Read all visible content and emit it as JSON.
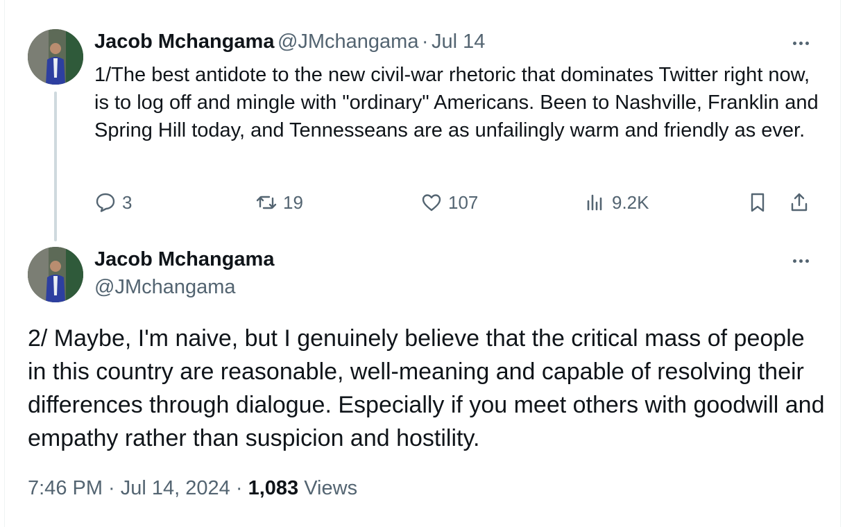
{
  "colors": {
    "text_primary": "#0f1419",
    "text_secondary": "#536471",
    "thread_line": "#cfd9de"
  },
  "tweet1": {
    "author_name": "Jacob Mchangama",
    "handle": "@JMchangama",
    "separator": "·",
    "date": "Jul 14",
    "text": "1/The best antidote to the new civil-war rhetoric that dominates Twitter right now, is to log off and mingle with \"ordinary\" Americans. Been to Nashville, Franklin and Spring Hill today, and Tennesseans are as unfailingly warm and friendly as ever.",
    "actions": {
      "replies": "3",
      "reposts": "19",
      "likes": "107",
      "views": "9.2K"
    },
    "icons": [
      "reply-icon",
      "repost-icon",
      "like-icon",
      "views-icon",
      "bookmark-icon",
      "share-icon",
      "more-icon"
    ]
  },
  "tweet2": {
    "author_name": "Jacob Mchangama",
    "handle": "@JMchangama",
    "text": "2/ Maybe, I'm naive, but I genuinely believe that the critical mass of people in this country are reasonable, well-meaning and capable of resolving their differences through dialogue. Especially if you meet others with goodwill and empathy rather than suspicion and hostility.",
    "timestamp": "7:46 PM · Jul 14, 2024",
    "separator": "·",
    "views_count": "1,083",
    "views_label": "Views"
  }
}
